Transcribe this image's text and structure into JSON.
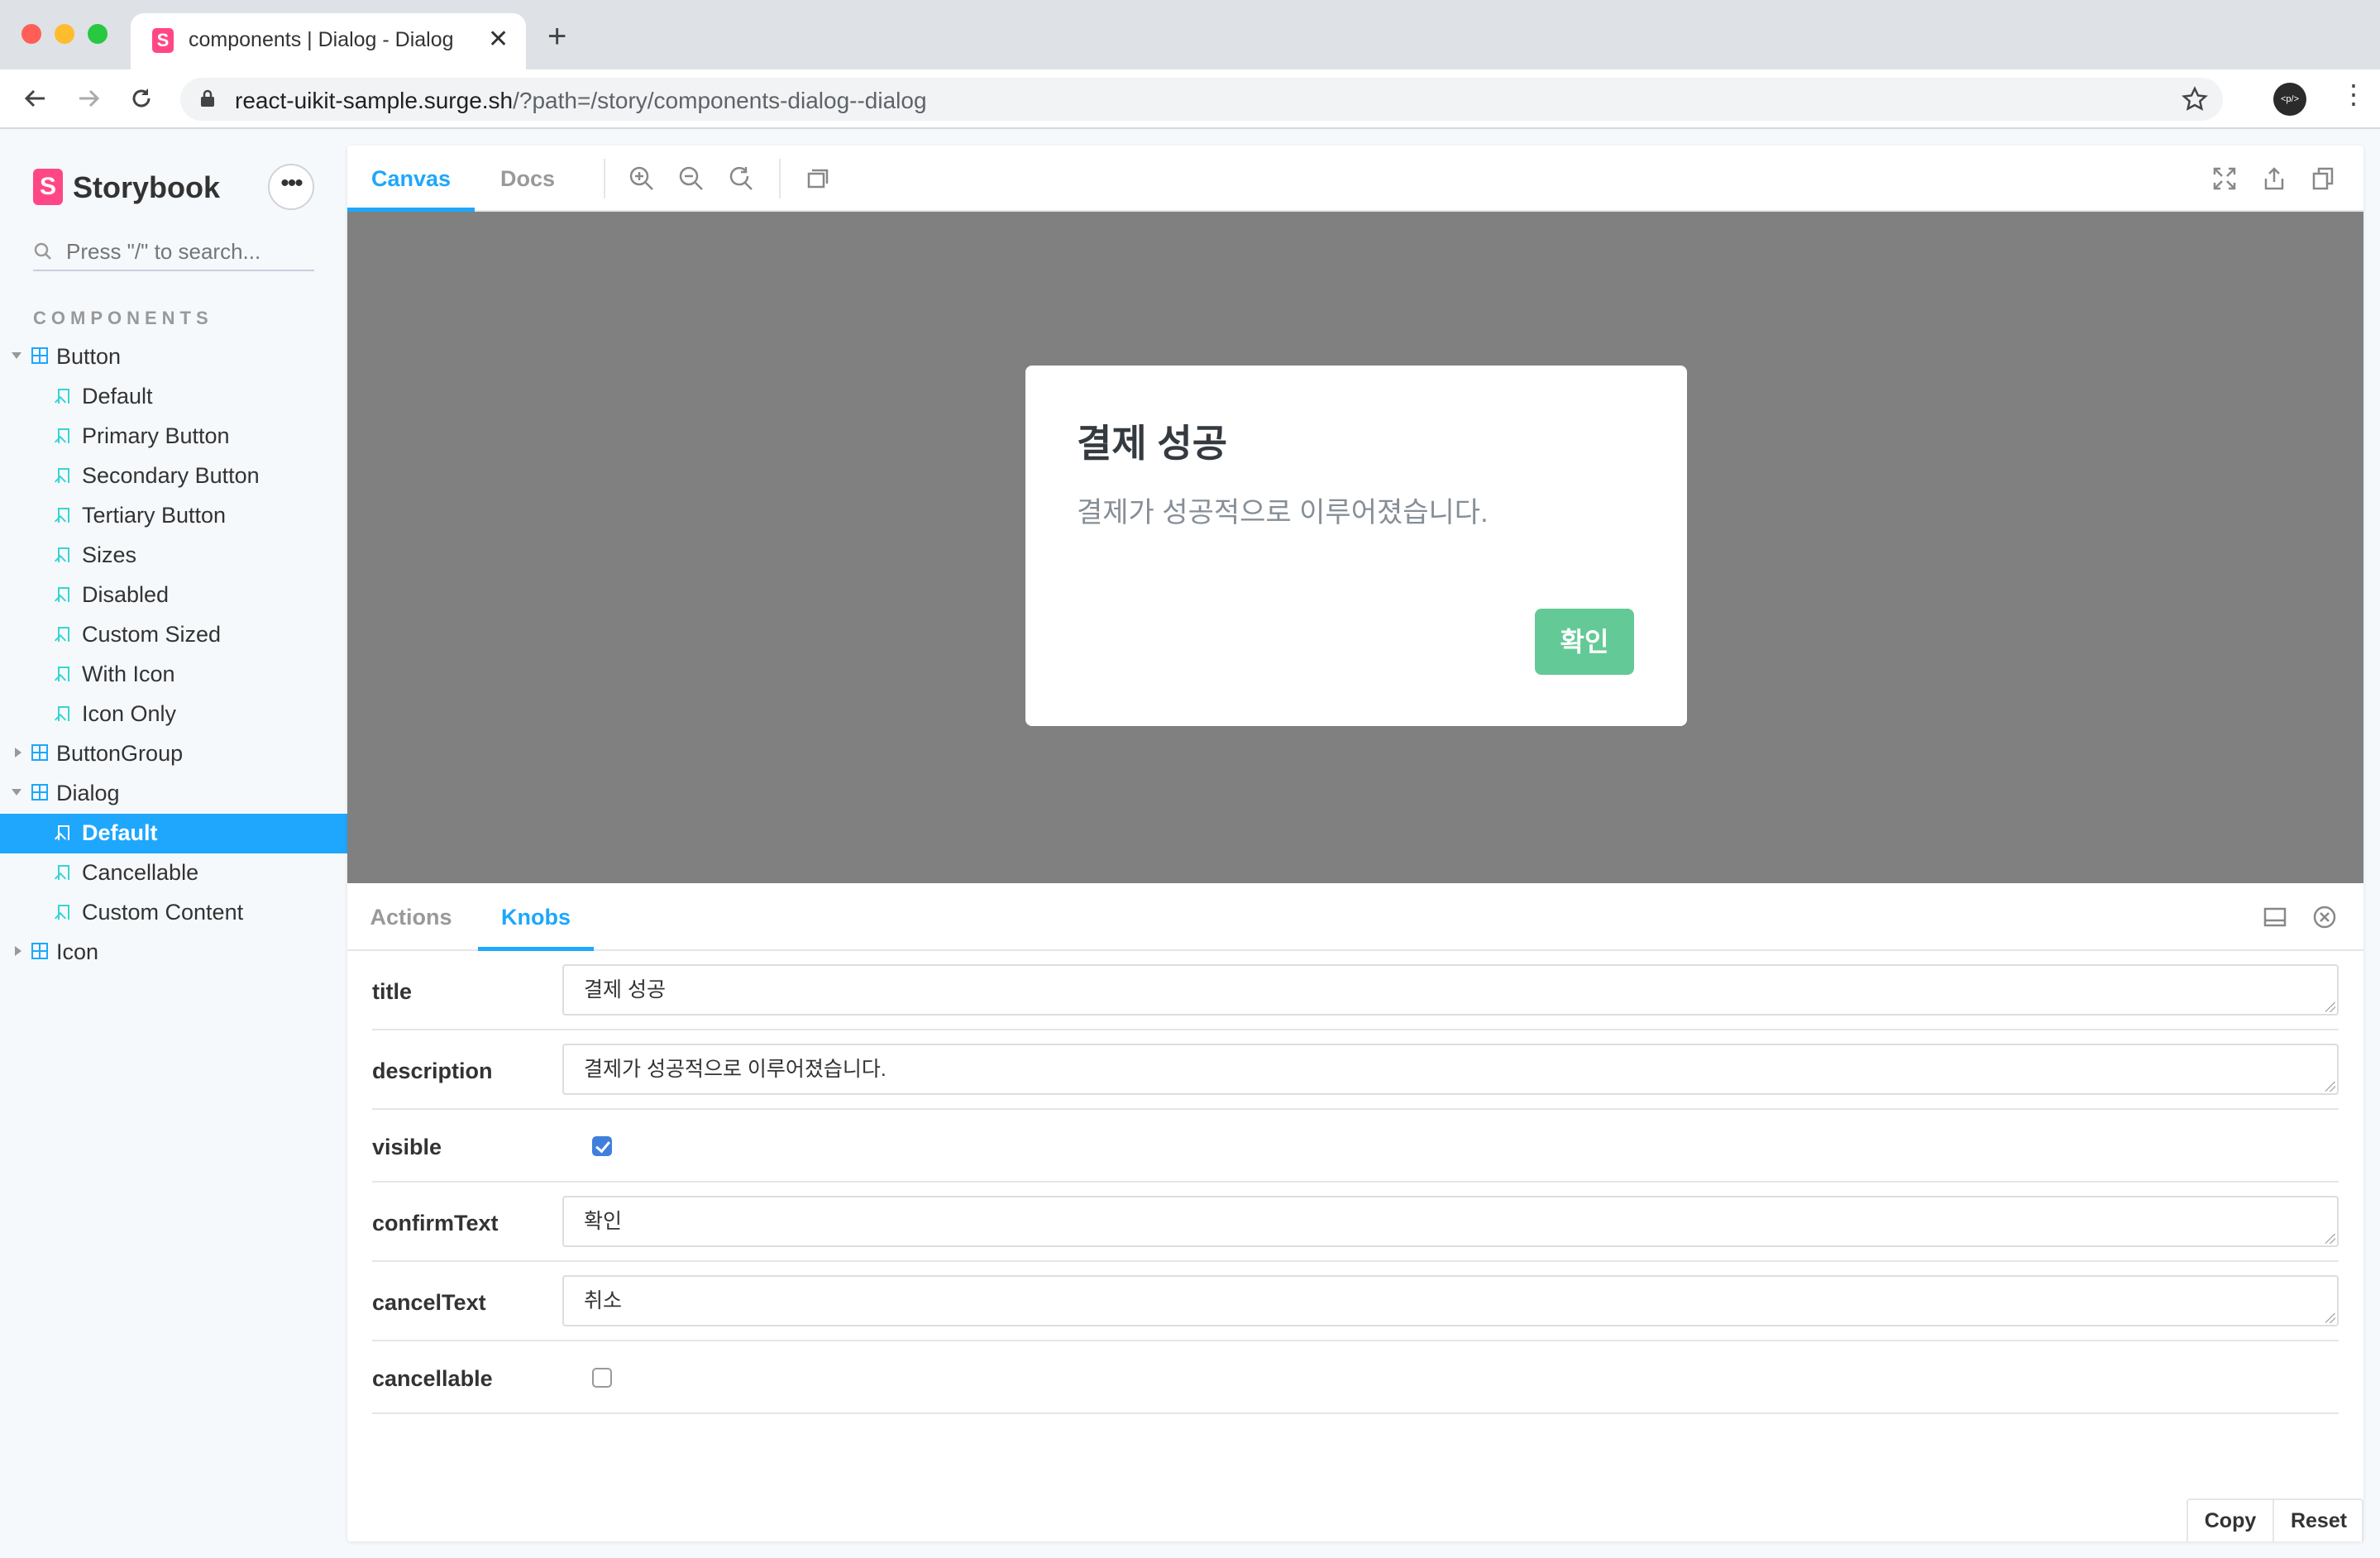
{
  "browser": {
    "tab_title": "components | Dialog - Dialog",
    "url_host": "react-uikit-sample.surge.sh",
    "url_path": "/?path=/story/components-dialog--dialog",
    "avatar_text": "<p/>"
  },
  "sidebar": {
    "logo_letter": "S",
    "brand": "Storybook",
    "menu_label": "•••",
    "search_placeholder": "Press \"/\" to search...",
    "section_title": "COMPONENTS",
    "components": [
      {
        "label": "Button",
        "expanded": true,
        "stories": [
          "Default",
          "Primary Button",
          "Secondary Button",
          "Tertiary Button",
          "Sizes",
          "Disabled",
          "Custom Sized",
          "With Icon",
          "Icon Only"
        ]
      },
      {
        "label": "ButtonGroup",
        "expanded": false,
        "stories": []
      },
      {
        "label": "Dialog",
        "expanded": true,
        "stories": [
          "Default",
          "Cancellable",
          "Custom Content"
        ]
      },
      {
        "label": "Icon",
        "expanded": false,
        "stories": []
      }
    ],
    "selected_story": "Dialog/Default"
  },
  "toolbar": {
    "tabs": [
      "Canvas",
      "Docs"
    ],
    "active_tab": "Canvas",
    "tools": [
      "zoom-in-icon",
      "zoom-out-icon",
      "zoom-reset-icon",
      "background-grid-icon"
    ],
    "right_tools": [
      "fullscreen-icon",
      "share-icon",
      "copy-link-icon"
    ]
  },
  "preview": {
    "backdrop_color": "#808080",
    "dialog": {
      "title": "결제 성공",
      "description": "결제가 성공적으로 이루어졌습니다.",
      "confirm": "확인",
      "confirm_color": "#63c997"
    }
  },
  "addons": {
    "tabs": [
      "Actions",
      "Knobs"
    ],
    "active_tab": "Knobs",
    "knobs": {
      "title": {
        "label": "title",
        "value": "결제 성공"
      },
      "description": {
        "label": "description",
        "value": "결제가 성공적으로 이루어졌습니다."
      },
      "visible": {
        "label": "visible",
        "checked": true
      },
      "confirmText": {
        "label": "confirmText",
        "value": "확인"
      },
      "cancelText": {
        "label": "cancelText",
        "value": "취소"
      },
      "cancellable": {
        "label": "cancellable",
        "checked": false
      }
    },
    "copy_label": "Copy",
    "reset_label": "Reset"
  },
  "colors": {
    "accent": "#1ea7fd",
    "brand": "#ff4785",
    "story_icon": "#37d5d3"
  }
}
